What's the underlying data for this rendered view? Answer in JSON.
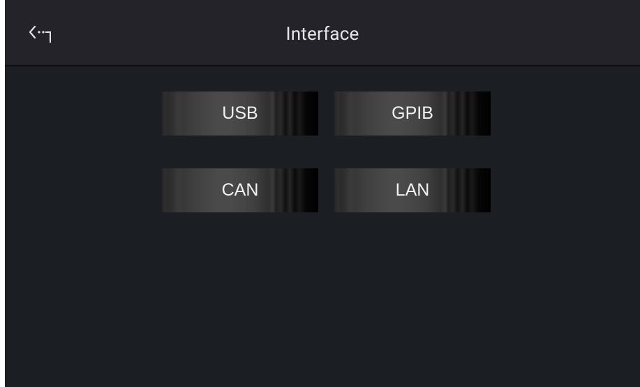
{
  "header": {
    "title": "Interface",
    "back_icon": "back-arrow-icon"
  },
  "interfaces": [
    {
      "label": "USB"
    },
    {
      "label": "GPIB"
    },
    {
      "label": "CAN"
    },
    {
      "label": "LAN"
    }
  ],
  "colors": {
    "background": "#1b1e22",
    "header": "#25232a",
    "text": "#e6e6e6"
  }
}
